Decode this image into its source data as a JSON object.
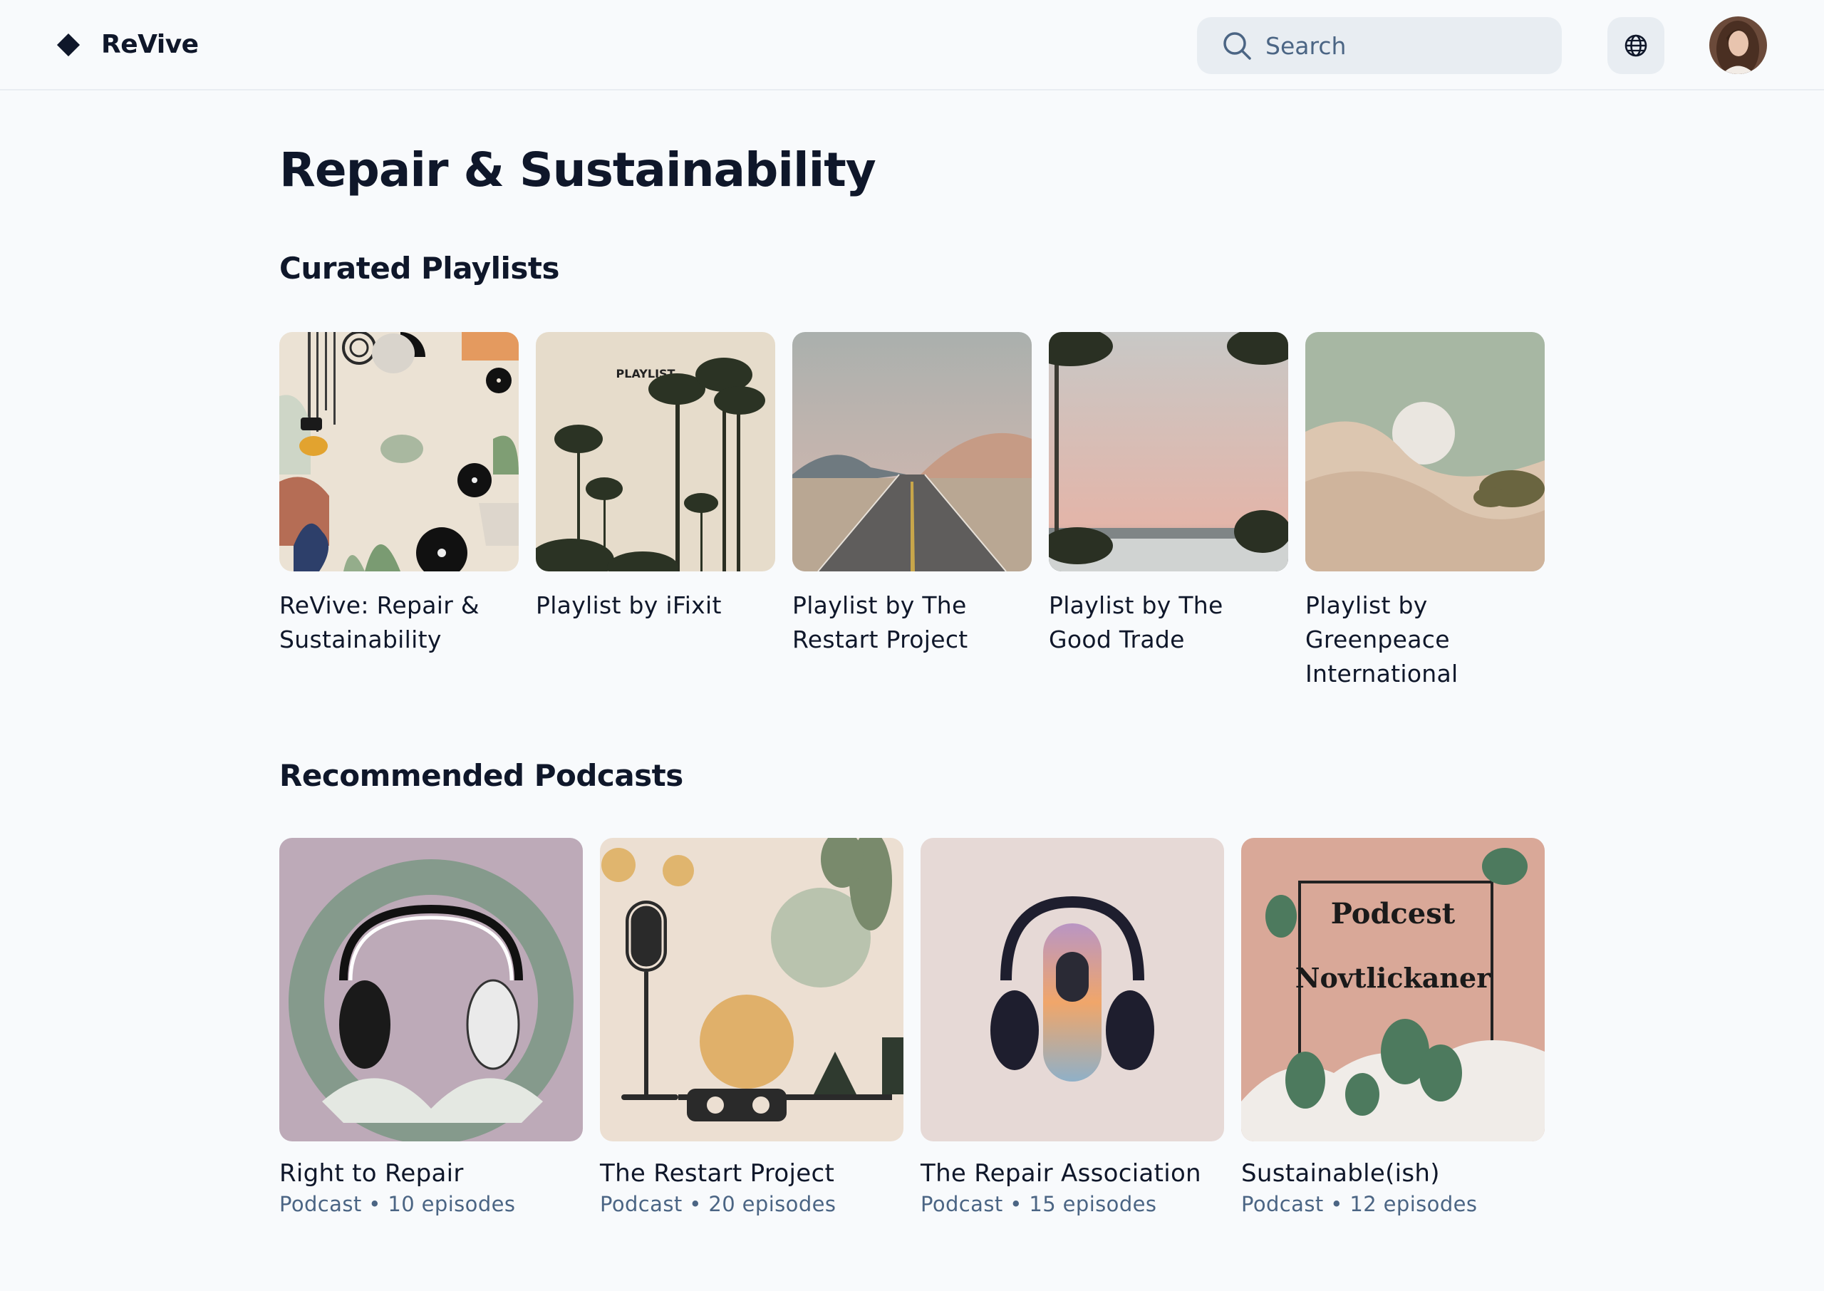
{
  "header": {
    "app_name": "ReVive",
    "search_placeholder": "Search"
  },
  "page": {
    "title": "Repair & Sustainability"
  },
  "playlists": {
    "section_title": "Curated Playlists",
    "items": [
      {
        "title": "ReVive: Repair & Sustainability"
      },
      {
        "title": "Playlist by iFixit",
        "cover_text": "PLAYLIST"
      },
      {
        "title": "Playlist by The Restart Project"
      },
      {
        "title": "Playlist by The Good Trade"
      },
      {
        "title": "Playlist by Greenpeace International"
      }
    ]
  },
  "podcasts": {
    "section_title": "Recommended Podcasts",
    "items": [
      {
        "title": "Right to Repair",
        "meta": "Podcast • 10 episodes"
      },
      {
        "title": "The Restart Project",
        "meta": "Podcast • 20 episodes"
      },
      {
        "title": "The Repair Association",
        "meta": "Podcast • 15 episodes"
      },
      {
        "title": "Sustainable(ish)",
        "meta": "Podcast • 12 episodes",
        "cover_text_1": "Podcest",
        "cover_text_2": "Novtlickaner"
      }
    ]
  }
}
